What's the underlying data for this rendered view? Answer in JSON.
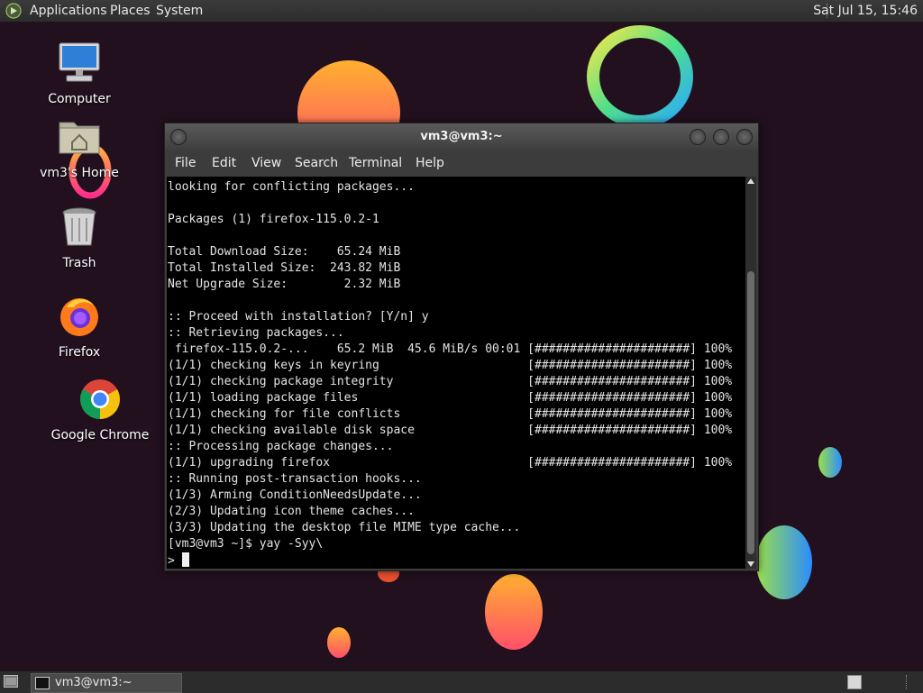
{
  "top_panel": {
    "menus": [
      "Applications",
      "Places",
      "System"
    ],
    "clock": "Sat Jul 15, 15:46"
  },
  "desktop_icons": [
    {
      "label": "Computer",
      "icon": "computer-icon"
    },
    {
      "label": "vm3's Home",
      "icon": "home-folder-icon"
    },
    {
      "label": "Trash",
      "icon": "trash-icon"
    },
    {
      "label": "Firefox",
      "icon": "firefox-icon"
    },
    {
      "label": "Google Chrome",
      "icon": "chrome-icon"
    }
  ],
  "terminal": {
    "title": "vm3@vm3:~",
    "menu": [
      "File",
      "Edit",
      "View",
      "Search",
      "Terminal",
      "Help"
    ],
    "output": "looking for conflicting packages...\n\nPackages (1) firefox-115.0.2-1\n\nTotal Download Size:    65.24 MiB\nTotal Installed Size:  243.82 MiB\nNet Upgrade Size:        2.32 MiB\n\n:: Proceed with installation? [Y/n] y\n:: Retrieving packages...\n firefox-115.0.2-...    65.2 MiB  45.6 MiB/s 00:01 [######################] 100%\n(1/1) checking keys in keyring                     [######################] 100%\n(1/1) checking package integrity                   [######################] 100%\n(1/1) loading package files                        [######################] 100%\n(1/1) checking for file conflicts                  [######################] 100%\n(1/1) checking available disk space                [######################] 100%\n:: Processing package changes...\n(1/1) upgrading firefox                            [######################] 100%\n:: Running post-transaction hooks...\n(1/3) Arming ConditionNeedsUpdate...\n(2/3) Updating icon theme caches...\n(3/3) Updating the desktop file MIME type cache...\n[vm3@vm3 ~]$ yay -Syy\\",
    "prompt": "> "
  },
  "taskbar": {
    "window_label": "vm3@vm3:~"
  },
  "colors": {
    "desktop_bg": "#22101f",
    "panel_bg": "#2c2c2c",
    "terminal_bg": "#000000",
    "terminal_fg": "#e4e4e4"
  }
}
